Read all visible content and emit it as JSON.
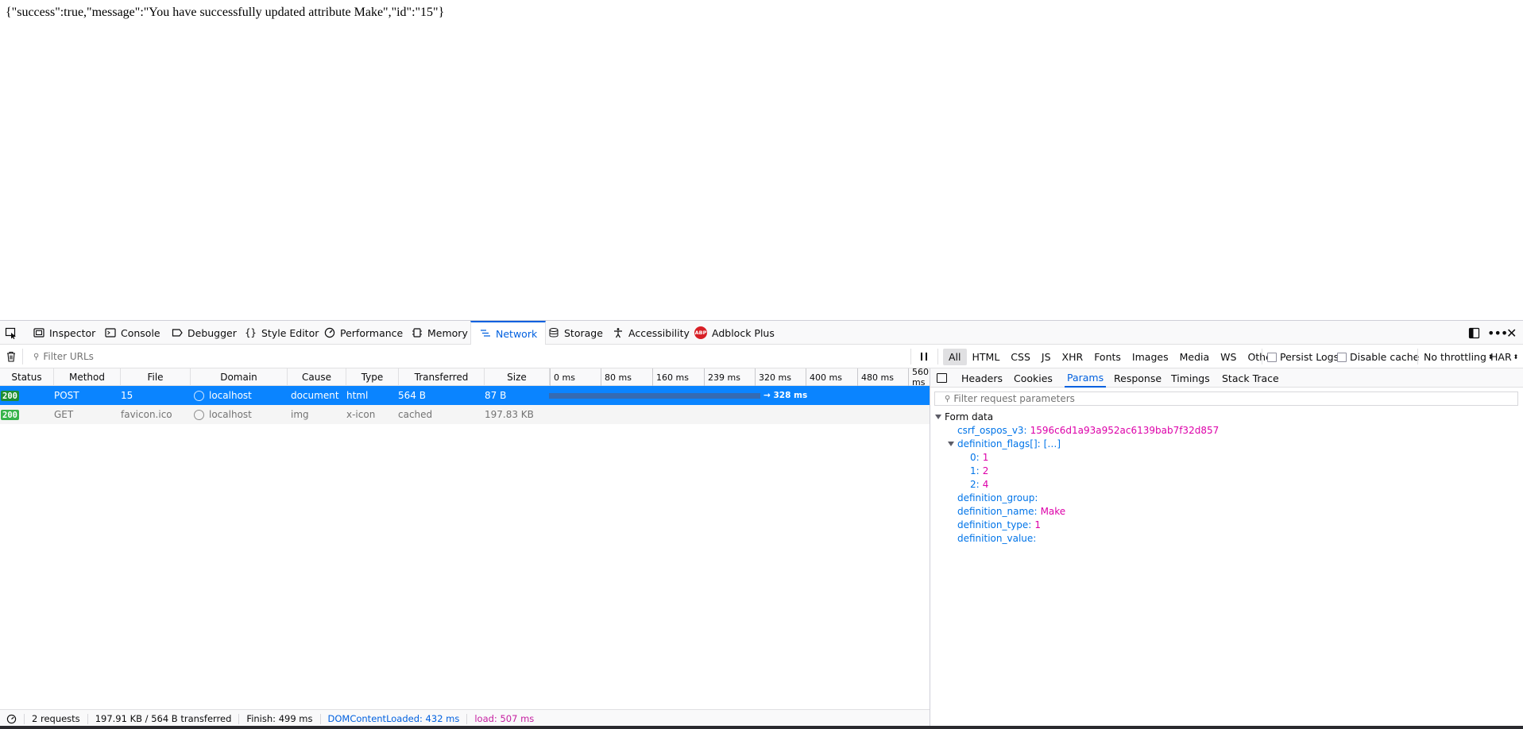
{
  "page": {
    "json_text": "{\"success\":true,\"message\":\"You have successfully updated attribute Make\",\"id\":\"15\"}"
  },
  "toolbox": {
    "tabs": [
      {
        "label": "Inspector",
        "icon": "inspector-icon"
      },
      {
        "label": "Console",
        "icon": "console-icon"
      },
      {
        "label": "Debugger",
        "icon": "debugger-icon"
      },
      {
        "label": "Style Editor",
        "icon": "style-editor-icon"
      },
      {
        "label": "Performance",
        "icon": "performance-icon"
      },
      {
        "label": "Memory",
        "icon": "memory-icon"
      },
      {
        "label": "Network",
        "icon": "network-icon",
        "active": true
      },
      {
        "label": "Storage",
        "icon": "storage-icon"
      },
      {
        "label": "Accessibility",
        "icon": "accessibility-icon"
      },
      {
        "label": "Adblock Plus",
        "icon": "adblock-plus-icon",
        "badge": "ABP"
      }
    ]
  },
  "network_toolbar": {
    "filter_placeholder": "Filter URLs",
    "type_filters": [
      "All",
      "HTML",
      "CSS",
      "JS",
      "XHR",
      "Fonts",
      "Images",
      "Media",
      "WS",
      "Other"
    ],
    "active_type_filter": "All",
    "persist_logs": "Persist Logs",
    "disable_cache": "Disable cache",
    "throttling": "No throttling",
    "har": "HAR"
  },
  "columns": [
    "Status",
    "Method",
    "File",
    "Domain",
    "Cause",
    "Type",
    "Transferred",
    "Size"
  ],
  "waterfall_ticks": [
    "0 ms",
    "80 ms",
    "160 ms",
    "239 ms",
    "320 ms",
    "400 ms",
    "480 ms",
    "560 ms"
  ],
  "requests": [
    {
      "status": "200",
      "method": "POST",
      "file": "15",
      "domain": "localhost",
      "cause": "document",
      "type": "html",
      "transferred": "564 B",
      "size": "87 B",
      "timing": "→ 328 ms",
      "selected": true
    },
    {
      "status": "200",
      "method": "GET",
      "file": "favicon.ico",
      "domain": "localhost",
      "cause": "img",
      "type": "x-icon",
      "transferred": "cached",
      "size": "197.83 KB",
      "timing": "",
      "selected": false
    }
  ],
  "details": {
    "tabs": [
      "Headers",
      "Cookies",
      "Params",
      "Response",
      "Timings",
      "Stack Trace"
    ],
    "active_tab": "Params",
    "filter_placeholder": "Filter request parameters",
    "section_title": "Form data",
    "params": {
      "csrf_key": "csrf_ospos_v3:",
      "csrf_val": "1596c6d1a93a952ac6139bab7f32d857",
      "flags_key": "definition_flags[]:",
      "flags_val": "[…]",
      "flag_items": [
        {
          "k": "0:",
          "v": "1"
        },
        {
          "k": "1:",
          "v": "2"
        },
        {
          "k": "2:",
          "v": "4"
        }
      ],
      "group_key": "definition_group:",
      "group_val": "",
      "name_key": "definition_name:",
      "name_val": "Make",
      "type_key": "definition_type:",
      "type_val": "1",
      "value_key": "definition_value:",
      "value_val": ""
    }
  },
  "statusbar": {
    "requests": "2 requests",
    "transferred": "197.91 KB / 564 B transferred",
    "finish": "Finish: 499 ms",
    "dcl": "DOMContentLoaded: 432 ms",
    "load": "load: 507 ms"
  },
  "colors": {
    "accent": "#0060df",
    "selected_row": "#0a84ff",
    "status_ok": "#1d8e32",
    "param_key": "#0074e8",
    "param_value": "#dd00a9",
    "load_line": "#c51fa0"
  }
}
